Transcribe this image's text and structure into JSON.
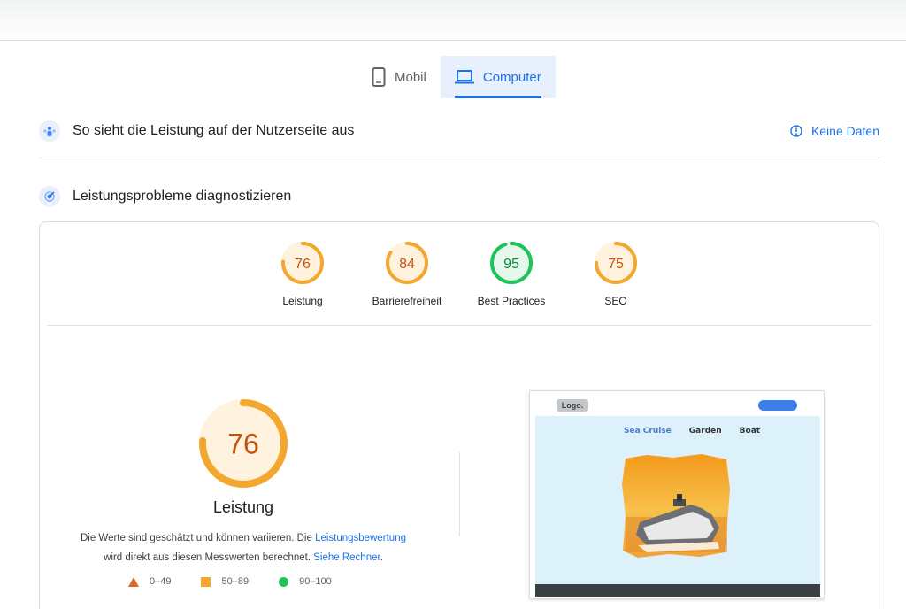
{
  "tabs": [
    {
      "label": "Mobil",
      "icon": "smartphone-icon",
      "active": false
    },
    {
      "label": "Computer",
      "icon": "laptop-icon",
      "active": true
    }
  ],
  "field_section": {
    "title": "So sieht die Leistung auf der Nutzerseite aus",
    "icon": "users-icon",
    "no_data_label": "Keine Daten",
    "no_data_icon": "info-icon"
  },
  "lab_section": {
    "title": "Leistungsprobleme diagnostizieren",
    "icon": "diagnostics-icon"
  },
  "scores": [
    {
      "label": "Leistung",
      "value": "76",
      "fraction": 0.76,
      "color": "#f4a72e",
      "text_color": "#c5520d",
      "bg": "#fff3e0"
    },
    {
      "label": "Barrierefreiheit",
      "value": "84",
      "fraction": 0.84,
      "color": "#f4a72e",
      "text_color": "#c5520d",
      "bg": "#fff3e0"
    },
    {
      "label": "Best Practices",
      "value": "95",
      "fraction": 0.95,
      "color": "#1ec35a",
      "text_color": "#0c8a3e",
      "bg": "#e6f7ec"
    },
    {
      "label": "SEO",
      "value": "75",
      "fraction": 0.75,
      "color": "#f4a72e",
      "text_color": "#c5520d",
      "bg": "#fff3e0"
    }
  ],
  "main_score": {
    "value": "76",
    "fraction": 0.76,
    "title": "Leistung",
    "color": "#f4a72e",
    "text_color": "#c5520d",
    "bg": "#fff3e0"
  },
  "description": {
    "part1": "Die Werte sind geschätzt und können variieren. Die ",
    "link1": "Leistungsbewertung",
    "part2": " wird direkt aus diesen Messwerten berechnet. ",
    "link2": "Siehe Rechner",
    "part3": "."
  },
  "legend": [
    {
      "range": "0–49",
      "shape": "triangle",
      "color": "#e0662a"
    },
    {
      "range": "50–89",
      "shape": "square",
      "color": "#f4a72e"
    },
    {
      "range": "90–100",
      "shape": "circle",
      "color": "#1ec35a"
    }
  ],
  "preview": {
    "logo": "Logo.",
    "nav": [
      "Sea Cruise",
      "Garden",
      "Boat"
    ]
  }
}
